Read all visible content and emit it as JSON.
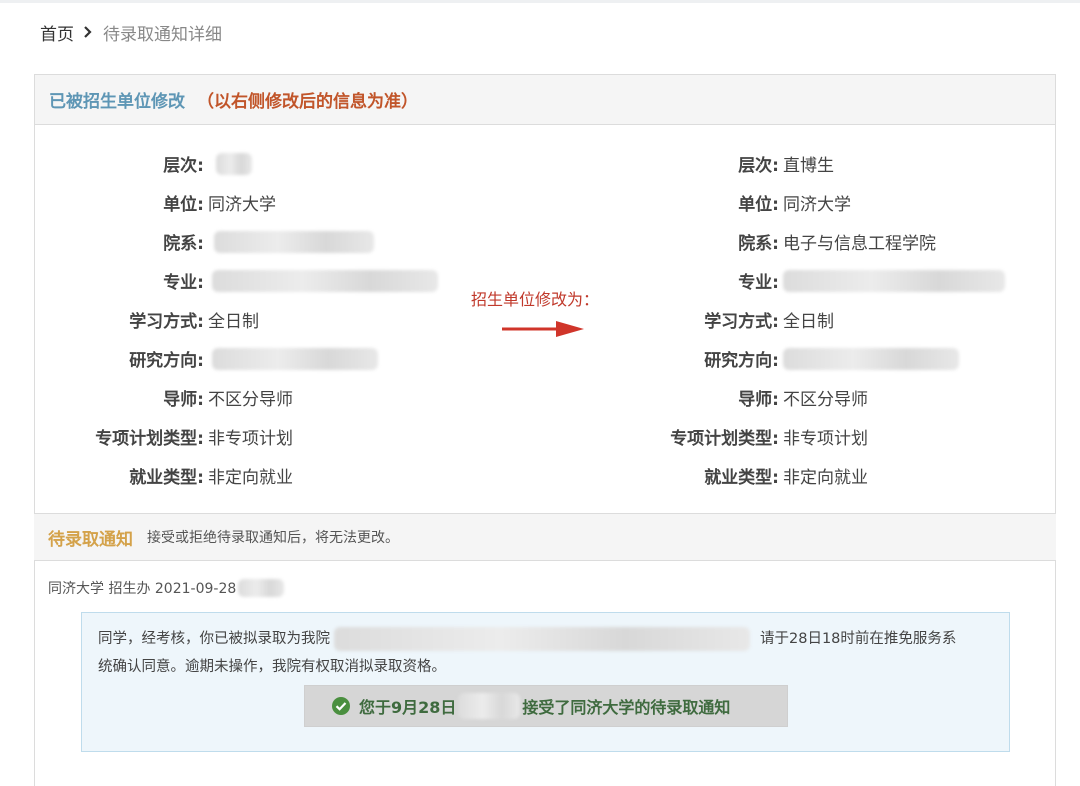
{
  "breadcrumb": {
    "home": "首页",
    "current": "待录取通知详细"
  },
  "modification": {
    "label": "已被招生单位修改",
    "note": "（以右侧修改后的信息为准）",
    "change_note": "招生单位修改为："
  },
  "original": [
    {
      "label": "层次:",
      "value": ""
    },
    {
      "label": "单位:",
      "value": "同济大学"
    },
    {
      "label": "院系:",
      "value": ""
    },
    {
      "label": "专业:",
      "value": ""
    },
    {
      "label": "学习方式:",
      "value": "全日制"
    },
    {
      "label": "研究方向:",
      "value": ""
    },
    {
      "label": "导师:",
      "value": "不区分导师"
    },
    {
      "label": "专项计划类型:",
      "value": "非专项计划"
    },
    {
      "label": "就业类型:",
      "value": "非定向就业"
    }
  ],
  "modified": [
    {
      "label": "层次:",
      "value": "直博生"
    },
    {
      "label": "单位:",
      "value": "同济大学"
    },
    {
      "label": "院系:",
      "value": "电子与信息工程学院"
    },
    {
      "label": "专业:",
      "value": ""
    },
    {
      "label": "学习方式:",
      "value": "全日制"
    },
    {
      "label": "研究方向:",
      "value": ""
    },
    {
      "label": "导师:",
      "value": "不区分导师"
    },
    {
      "label": "专项计划类型:",
      "value": "非专项计划"
    },
    {
      "label": "就业类型:",
      "value": "非定向就业"
    }
  ],
  "notice": {
    "title": "待录取通知",
    "tip": "接受或拒绝待录取通知后，将无法更改。",
    "sender": "同济大学 招生办 2021-09-28",
    "message_line1_start": "同学，经考核，你已被拟录取为我院",
    "message_line1_end": "请于28日18时前在推免服务系",
    "message_line2": "统确认同意。逾期未操作，我院有权取消拟录取资格。",
    "status_start": "您于9月28日",
    "status_end": "接受了同济大学的待录取通知"
  },
  "colors": {
    "modified_label": "#5e96b5",
    "modified_note": "#c1552a",
    "notice_title": "#d4a24a",
    "arrow": "#d0352a",
    "status_text": "#3f6b3f"
  }
}
